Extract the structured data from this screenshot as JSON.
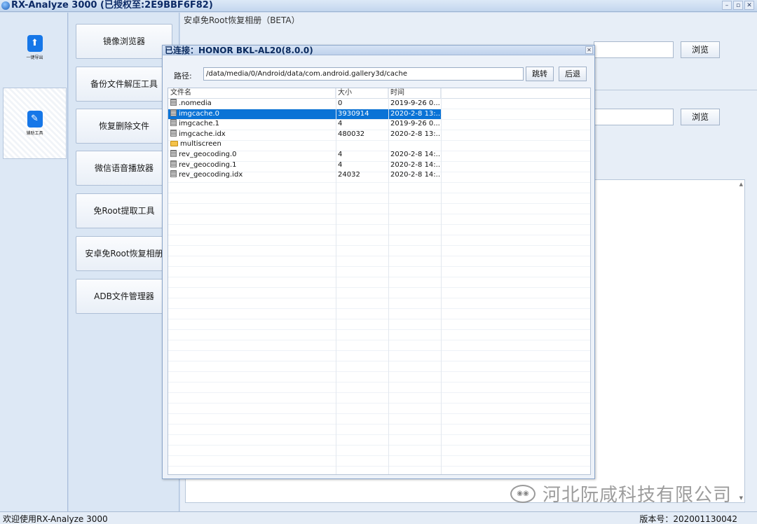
{
  "window": {
    "title": "RX-Analyze 3000 (已授权至:2E9BBF6F82)",
    "controls": [
      "–",
      "▫",
      "✕"
    ]
  },
  "leftnav": {
    "items": [
      {
        "label": "一键导出",
        "icon": "export-icon"
      },
      {
        "label": "辅助工具",
        "icon": "pencil-icon"
      }
    ]
  },
  "tools": [
    "镜像浏览器",
    "备份文件解压工具",
    "恢复删除文件",
    "微信语音播放器",
    "免Root提取工具",
    "安卓免Root恢复相册",
    "ADB文件管理器"
  ],
  "panel": {
    "title": "安卓免Root恢复相册（BETA）",
    "browse1": "浏览",
    "browse2": "浏览"
  },
  "dialog": {
    "title": "已连接：HONOR BKL-AL20(8.0.0)",
    "close": "✕",
    "path_label": "路径:",
    "path_value": "/data/media/0/Android/data/com.android.gallery3d/cache",
    "goto_label": "跳转",
    "back_label": "后退",
    "columns": [
      "文件名",
      "大小",
      "时间"
    ],
    "files": [
      {
        "name": ".nomedia",
        "size": "0",
        "time": "2019-9-26 0...",
        "type": "file"
      },
      {
        "name": "imgcache.0",
        "size": "3930914",
        "time": "2020-2-8 13:...",
        "type": "file",
        "selected": true
      },
      {
        "name": "imgcache.1",
        "size": "4",
        "time": "2019-9-26 0...",
        "type": "file"
      },
      {
        "name": "imgcache.idx",
        "size": "480032",
        "time": "2020-2-8 13:...",
        "type": "file"
      },
      {
        "name": "multiscreen",
        "size": "",
        "time": "",
        "type": "folder"
      },
      {
        "name": "rev_geocoding.0",
        "size": "4",
        "time": "2020-2-8 14:...",
        "type": "file"
      },
      {
        "name": "rev_geocoding.1",
        "size": "4",
        "time": "2020-2-8 14:...",
        "type": "file"
      },
      {
        "name": "rev_geocoding.idx",
        "size": "24032",
        "time": "2020-2-8 14:...",
        "type": "file"
      }
    ]
  },
  "watermark": {
    "text": "河北阮咸科技有限公司"
  },
  "status": {
    "left": "欢迎使用RX-Analyze 3000",
    "right": "版本号：202001130042"
  },
  "colors": {
    "selection": "#0a73d6",
    "accent": "#1677e8"
  }
}
